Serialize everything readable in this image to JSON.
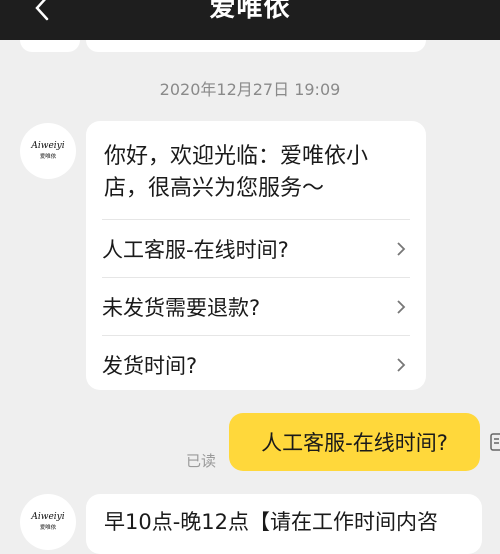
{
  "header": {
    "title": "爱唯依",
    "back_icon": "chevron-left-icon"
  },
  "chat": {
    "timestamp": "2020年12月27日 19:09",
    "bot_avatar": {
      "brand": "Aiweiyi",
      "name": "爱唯依"
    },
    "welcome": {
      "greeting": "你好，欢迎光临：爱唯依小店，很高兴为您服务～",
      "faq": [
        {
          "label": "人工客服-在线时间?"
        },
        {
          "label": "未发货需要退款?"
        },
        {
          "label": "发货时间?"
        }
      ]
    },
    "user_message": {
      "text": "人工客服-在线时间?",
      "read_status": "已读"
    },
    "bot_reply": {
      "text": "早10点-晚12点【请在工作时间内咨"
    }
  },
  "colors": {
    "header_bg": "#1e1e1e",
    "chat_bg": "#efefef",
    "user_bubble": "#ffd83b",
    "bot_bubble": "#ffffff"
  }
}
